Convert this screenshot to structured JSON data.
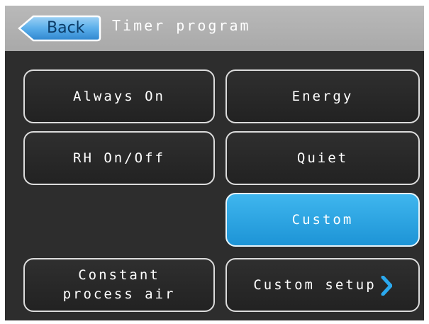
{
  "header": {
    "back_label": "Back",
    "title": "Timer program"
  },
  "buttons": {
    "always_on": "Always On",
    "energy": "Energy",
    "rh_on_off": "RH On/Off",
    "quiet": "Quiet",
    "custom": "Custom",
    "constant_process_air": {
      "line1": "Constant",
      "line2": "process air"
    },
    "custom_setup": "Custom setup"
  },
  "selected": "Custom",
  "icons": {
    "custom_setup": "chevron-right-icon"
  },
  "colors": {
    "header_bg": "#b0b0b0",
    "screen_bg": "#2d2d2d",
    "accent_blue": "#2aa5e3",
    "back_button_blue": "#3d9be0"
  }
}
